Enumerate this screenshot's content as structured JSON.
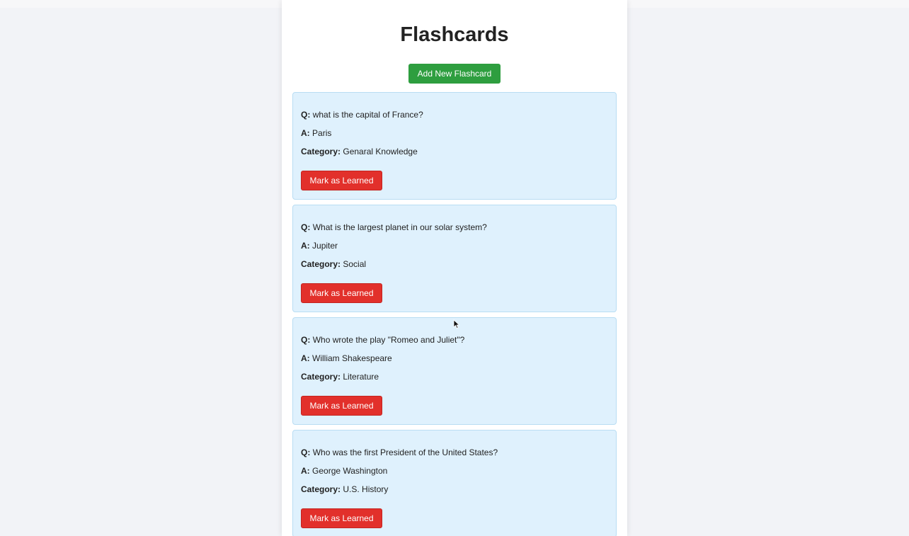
{
  "page": {
    "title": "Flashcards",
    "add_button_label": "Add New Flashcard"
  },
  "labels": {
    "question": "Q:",
    "answer": "A:",
    "category": "Category:"
  },
  "cards": [
    {
      "question": "what is the capital of France?",
      "answer": "Paris",
      "category": "Genaral Knowledge",
      "button_label": "Mark as Learned"
    },
    {
      "question": "What is the largest planet in our solar system?",
      "answer": "Jupiter",
      "category": "Social",
      "button_label": "Mark as Learned"
    },
    {
      "question": "Who wrote the play \"Romeo and Juliet\"?",
      "answer": "William Shakespeare",
      "category": "Literature",
      "button_label": "Mark as Learned"
    },
    {
      "question": "Who was the first President of the United States?",
      "answer": "George Washington",
      "category": "U.S. History",
      "button_label": "Mark as Learned"
    }
  ],
  "colors": {
    "add_button": "#2e9e3f",
    "learn_button": "#e2302b",
    "card_background": "#dff1fd",
    "page_background": "#f2f3f7"
  }
}
